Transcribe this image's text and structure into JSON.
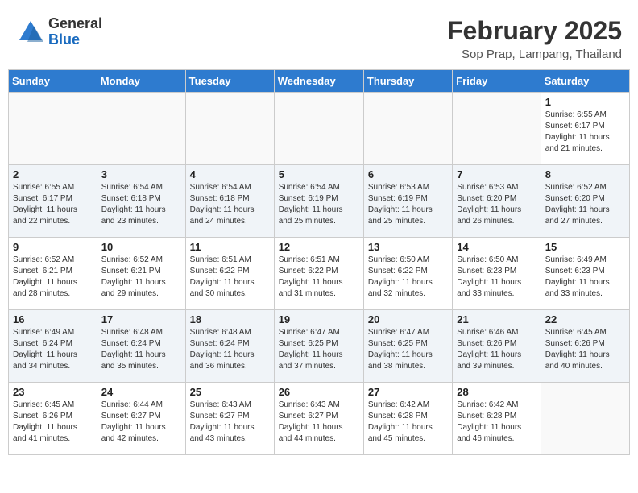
{
  "logo": {
    "general": "General",
    "blue": "Blue"
  },
  "title": "February 2025",
  "location": "Sop Prap, Lampang, Thailand",
  "days_of_week": [
    "Sunday",
    "Monday",
    "Tuesday",
    "Wednesday",
    "Thursday",
    "Friday",
    "Saturday"
  ],
  "weeks": [
    [
      {
        "day": "",
        "info": ""
      },
      {
        "day": "",
        "info": ""
      },
      {
        "day": "",
        "info": ""
      },
      {
        "day": "",
        "info": ""
      },
      {
        "day": "",
        "info": ""
      },
      {
        "day": "",
        "info": ""
      },
      {
        "day": "1",
        "info": "Sunrise: 6:55 AM\nSunset: 6:17 PM\nDaylight: 11 hours\nand 21 minutes."
      }
    ],
    [
      {
        "day": "2",
        "info": "Sunrise: 6:55 AM\nSunset: 6:17 PM\nDaylight: 11 hours\nand 22 minutes."
      },
      {
        "day": "3",
        "info": "Sunrise: 6:54 AM\nSunset: 6:18 PM\nDaylight: 11 hours\nand 23 minutes."
      },
      {
        "day": "4",
        "info": "Sunrise: 6:54 AM\nSunset: 6:18 PM\nDaylight: 11 hours\nand 24 minutes."
      },
      {
        "day": "5",
        "info": "Sunrise: 6:54 AM\nSunset: 6:19 PM\nDaylight: 11 hours\nand 25 minutes."
      },
      {
        "day": "6",
        "info": "Sunrise: 6:53 AM\nSunset: 6:19 PM\nDaylight: 11 hours\nand 25 minutes."
      },
      {
        "day": "7",
        "info": "Sunrise: 6:53 AM\nSunset: 6:20 PM\nDaylight: 11 hours\nand 26 minutes."
      },
      {
        "day": "8",
        "info": "Sunrise: 6:52 AM\nSunset: 6:20 PM\nDaylight: 11 hours\nand 27 minutes."
      }
    ],
    [
      {
        "day": "9",
        "info": "Sunrise: 6:52 AM\nSunset: 6:21 PM\nDaylight: 11 hours\nand 28 minutes."
      },
      {
        "day": "10",
        "info": "Sunrise: 6:52 AM\nSunset: 6:21 PM\nDaylight: 11 hours\nand 29 minutes."
      },
      {
        "day": "11",
        "info": "Sunrise: 6:51 AM\nSunset: 6:22 PM\nDaylight: 11 hours\nand 30 minutes."
      },
      {
        "day": "12",
        "info": "Sunrise: 6:51 AM\nSunset: 6:22 PM\nDaylight: 11 hours\nand 31 minutes."
      },
      {
        "day": "13",
        "info": "Sunrise: 6:50 AM\nSunset: 6:22 PM\nDaylight: 11 hours\nand 32 minutes."
      },
      {
        "day": "14",
        "info": "Sunrise: 6:50 AM\nSunset: 6:23 PM\nDaylight: 11 hours\nand 33 minutes."
      },
      {
        "day": "15",
        "info": "Sunrise: 6:49 AM\nSunset: 6:23 PM\nDaylight: 11 hours\nand 33 minutes."
      }
    ],
    [
      {
        "day": "16",
        "info": "Sunrise: 6:49 AM\nSunset: 6:24 PM\nDaylight: 11 hours\nand 34 minutes."
      },
      {
        "day": "17",
        "info": "Sunrise: 6:48 AM\nSunset: 6:24 PM\nDaylight: 11 hours\nand 35 minutes."
      },
      {
        "day": "18",
        "info": "Sunrise: 6:48 AM\nSunset: 6:24 PM\nDaylight: 11 hours\nand 36 minutes."
      },
      {
        "day": "19",
        "info": "Sunrise: 6:47 AM\nSunset: 6:25 PM\nDaylight: 11 hours\nand 37 minutes."
      },
      {
        "day": "20",
        "info": "Sunrise: 6:47 AM\nSunset: 6:25 PM\nDaylight: 11 hours\nand 38 minutes."
      },
      {
        "day": "21",
        "info": "Sunrise: 6:46 AM\nSunset: 6:26 PM\nDaylight: 11 hours\nand 39 minutes."
      },
      {
        "day": "22",
        "info": "Sunrise: 6:45 AM\nSunset: 6:26 PM\nDaylight: 11 hours\nand 40 minutes."
      }
    ],
    [
      {
        "day": "23",
        "info": "Sunrise: 6:45 AM\nSunset: 6:26 PM\nDaylight: 11 hours\nand 41 minutes."
      },
      {
        "day": "24",
        "info": "Sunrise: 6:44 AM\nSunset: 6:27 PM\nDaylight: 11 hours\nand 42 minutes."
      },
      {
        "day": "25",
        "info": "Sunrise: 6:43 AM\nSunset: 6:27 PM\nDaylight: 11 hours\nand 43 minutes."
      },
      {
        "day": "26",
        "info": "Sunrise: 6:43 AM\nSunset: 6:27 PM\nDaylight: 11 hours\nand 44 minutes."
      },
      {
        "day": "27",
        "info": "Sunrise: 6:42 AM\nSunset: 6:28 PM\nDaylight: 11 hours\nand 45 minutes."
      },
      {
        "day": "28",
        "info": "Sunrise: 6:42 AM\nSunset: 6:28 PM\nDaylight: 11 hours\nand 46 minutes."
      },
      {
        "day": "",
        "info": ""
      }
    ]
  ]
}
